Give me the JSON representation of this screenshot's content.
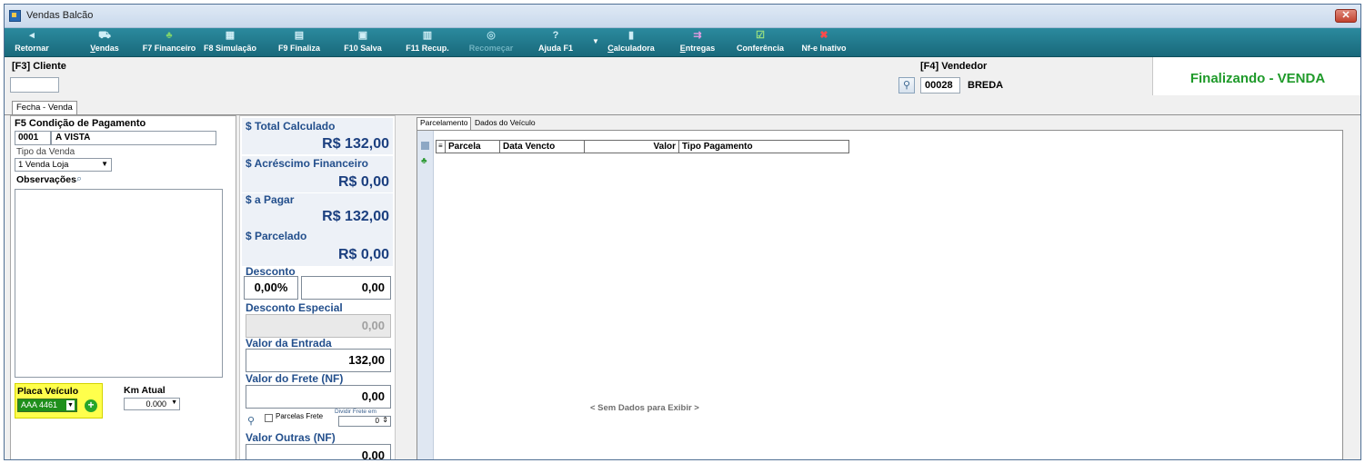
{
  "window": {
    "title": "Vendas Balcão"
  },
  "toolbar": [
    {
      "icon": "return-icon",
      "glyph": "◂",
      "prefix": "",
      "hotkey": "",
      "label": "Retornar"
    },
    {
      "icon": "cart-icon",
      "glyph": "⛟",
      "prefix": "",
      "hotkey": "V",
      "label": "endas"
    },
    {
      "icon": "money-icon",
      "glyph": "♣",
      "prefix": "",
      "hotkey": "",
      "label": "F7 Financeiro"
    },
    {
      "icon": "calc-grid-icon",
      "glyph": "▦",
      "prefix": "",
      "hotkey": "",
      "label": "F8 Simulação"
    },
    {
      "icon": "printer-icon",
      "glyph": "▤",
      "prefix": "",
      "hotkey": "",
      "label": "F9 Finaliza"
    },
    {
      "icon": "save-icon",
      "glyph": "▣",
      "prefix": "",
      "hotkey": "",
      "label": "F10 Salva"
    },
    {
      "icon": "recover-icon",
      "glyph": "▥",
      "prefix": "",
      "hotkey": "",
      "label": "F11 Recup."
    },
    {
      "icon": "recommerce-icon",
      "glyph": "◎",
      "prefix": "",
      "hotkey": "",
      "label": "Recomeçar"
    },
    {
      "icon": "help-icon",
      "glyph": "?",
      "prefix": "",
      "hotkey": "",
      "label": "Ajuda F1"
    },
    {
      "icon": "calculator-icon",
      "glyph": "▮",
      "prefix": "",
      "hotkey": "C",
      "label": "alculadora"
    },
    {
      "icon": "delivery-icon",
      "glyph": "⇉",
      "prefix": "",
      "hotkey": "E",
      "label": "ntregas"
    },
    {
      "icon": "checkbox-icon",
      "glyph": "☑",
      "prefix": "",
      "hotkey": "",
      "label": "Conferência"
    },
    {
      "icon": "nfe-x-icon",
      "glyph": "✖",
      "prefix": "",
      "hotkey": "",
      "label": "Nf-e Inativo"
    }
  ],
  "cliente": {
    "label": "[F3] Cliente",
    "value": ""
  },
  "vendedor": {
    "label": "[F4] Vendedor",
    "code": "00028",
    "name": "BREDA"
  },
  "status": {
    "text": "Finalizando - VENDA",
    "color": "#1f9a2a"
  },
  "main_tab": "Fecha - Venda",
  "left": {
    "cond_label": "F5 Condição de Pagamento",
    "cond_code": "0001",
    "cond_desc": "A VISTA",
    "tipo_label": "Tipo da Venda",
    "tipo_value": "1 Venda Loja",
    "obs_label": "Observações",
    "placa_label": "Placa Veículo",
    "placa_value": "AAA 4461",
    "km_label": "Km Atual",
    "km_value": "0.000"
  },
  "mid": {
    "total_label": "$ Total Calculado",
    "total_value": "R$ 132,00",
    "acresc_label": "$ Acréscimo Financeiro",
    "acresc_value": "R$ 0,00",
    "apagar_label": "$ a Pagar",
    "apagar_value": "R$ 132,00",
    "parcelado_label": "$ Parcelado",
    "parcelado_value": "R$ 0,00",
    "desconto_label": "Desconto",
    "desconto_pct": "0,00%",
    "desconto_val": "0,00",
    "desc_esp_label": "Desconto Especial",
    "desc_esp_val": "0,00",
    "entrada_label": "Valor da Entrada",
    "entrada_val": "132,00",
    "frete_label": "Valor do Frete (NF)",
    "frete_val": "0,00",
    "parcelas_frete_label": "Parcelas Frete",
    "dividir_label": "Dividir Frete em",
    "dividir_val": "0",
    "outras_label": "Valor Outras (NF)",
    "outras_val": "0,00"
  },
  "right": {
    "tabs": [
      "Parcelamento",
      "Dados do Veículo"
    ],
    "columns": [
      "Parcela",
      "Data Vencto",
      "Valor",
      "Tipo Pagamento"
    ],
    "empty": "< Sem Dados para Exibir >"
  }
}
